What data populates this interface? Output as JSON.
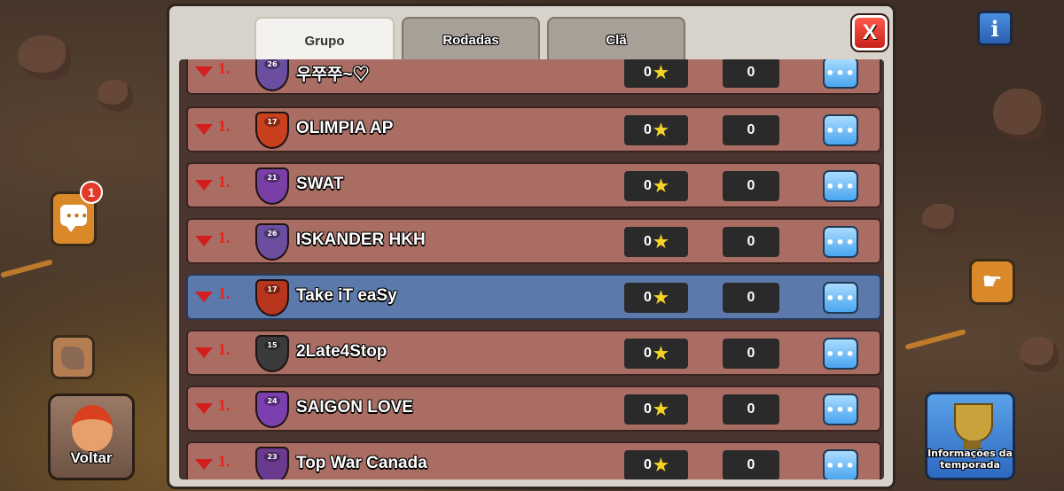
{
  "tabs": [
    {
      "label": "Grupo",
      "active": true
    },
    {
      "label": "Rodadas",
      "active": false
    },
    {
      "label": "Clã",
      "active": false
    }
  ],
  "close_label": "X",
  "info_label": "i",
  "chat_badge": "1",
  "back_label": "Voltar",
  "season_label": "Informações da temporada",
  "clans": [
    {
      "rank": "1.",
      "level": "26",
      "name": "우쭈쭈~♡",
      "stars": "0",
      "score": "0",
      "crest_color": "#6b4ea0"
    },
    {
      "rank": "1.",
      "level": "17",
      "name": "OLIMPIA AP",
      "stars": "0",
      "score": "0",
      "crest_color": "#c8401e"
    },
    {
      "rank": "1.",
      "level": "21",
      "name": "SWAT",
      "stars": "0",
      "score": "0",
      "crest_color": "#7a3fa6"
    },
    {
      "rank": "1.",
      "level": "26",
      "name": "ISKANDER HKH",
      "stars": "0",
      "score": "0",
      "crest_color": "#6b4ea0"
    },
    {
      "rank": "1.",
      "level": "17",
      "name": "Take iT eaSy",
      "stars": "0",
      "score": "0",
      "crest_color": "#b8361e",
      "highlighted": true
    },
    {
      "rank": "1.",
      "level": "15",
      "name": "2Late4Stop",
      "stars": "0",
      "score": "0",
      "crest_color": "#3b3b3b"
    },
    {
      "rank": "1.",
      "level": "24",
      "name": "SAIGON LOVE",
      "stars": "0",
      "score": "0",
      "crest_color": "#7b3fb0"
    },
    {
      "rank": "1.",
      "level": "23",
      "name": "Top War Canada",
      "stars": "0",
      "score": "0",
      "crest_color": "#6a3a8e"
    }
  ],
  "more_label": "•••"
}
